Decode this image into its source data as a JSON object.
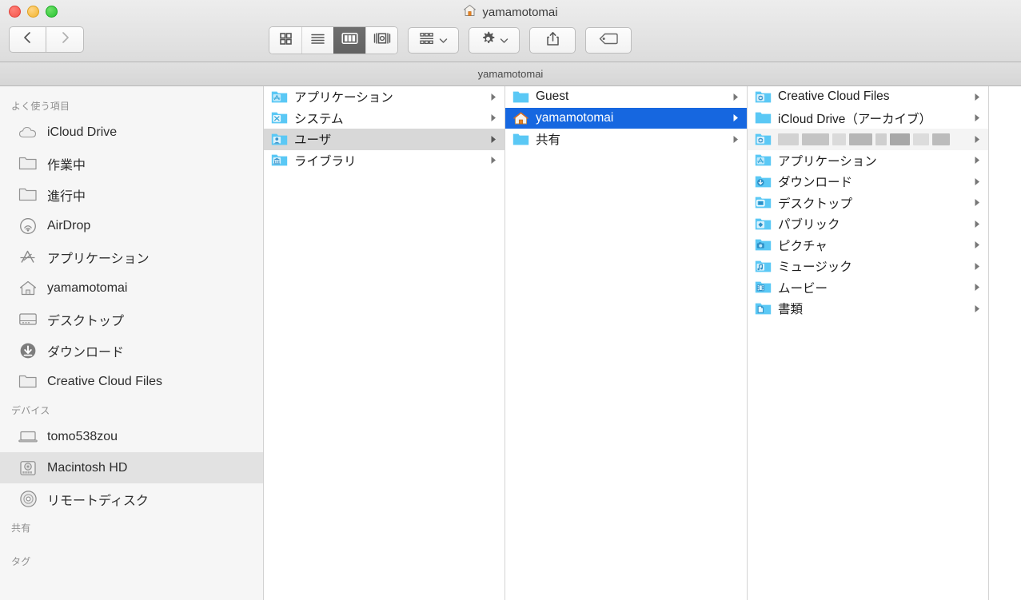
{
  "window": {
    "title": "yamamotomai",
    "title_icon": "home-icon",
    "path_bar_label": "yamamotomai",
    "accent_selection": "#1667e0",
    "folder_blue": "#5ac8f5",
    "sidebar_bg": "#f6f6f6"
  },
  "traffic_lights": [
    {
      "name": "close-button",
      "color": "#f4564c"
    },
    {
      "name": "minimize-button",
      "color": "#f2b42f"
    },
    {
      "name": "zoom-button",
      "color": "#28c231"
    }
  ],
  "nav": {
    "back_label": "back-arrow-icon",
    "forward_label": "forward-arrow-icon"
  },
  "toolbar": {
    "view_modes": [
      {
        "label": "icon-view",
        "icon": "grid-icon",
        "active": false
      },
      {
        "label": "list-view",
        "icon": "list-icon",
        "active": false
      },
      {
        "label": "column-view",
        "icon": "columns-icon",
        "active": true
      },
      {
        "label": "coverflow-view",
        "icon": "coverflow-icon",
        "active": false
      }
    ],
    "arrange_label": "arrange-icon",
    "action_label": "gear-icon",
    "share_label": "share-icon",
    "tags_label": "tag-icon"
  },
  "sidebar": {
    "sections": [
      {
        "header": "よく使う項目",
        "items": [
          {
            "label": "iCloud Drive",
            "icon": "icloud-icon",
            "selected": false
          },
          {
            "label": "作業中",
            "icon": "folder-icon",
            "selected": false
          },
          {
            "label": "進行中",
            "icon": "folder-icon",
            "selected": false
          },
          {
            "label": "AirDrop",
            "icon": "airdrop-icon",
            "selected": false
          },
          {
            "label": "アプリケーション",
            "icon": "applications-icon",
            "selected": false
          },
          {
            "label": "yamamotomai",
            "icon": "home-icon",
            "selected": false
          },
          {
            "label": "デスクトップ",
            "icon": "desktop-icon",
            "selected": false
          },
          {
            "label": "ダウンロード",
            "icon": "downloads-icon",
            "selected": false
          },
          {
            "label": "Creative Cloud Files",
            "icon": "folder-icon",
            "selected": false
          }
        ]
      },
      {
        "header": "デバイス",
        "items": [
          {
            "label": "tomo538zou",
            "icon": "laptop-icon",
            "selected": false
          },
          {
            "label": "Macintosh HD",
            "icon": "harddisk-icon",
            "selected": true
          },
          {
            "label": "リモートディスク",
            "icon": "disc-icon",
            "selected": false
          }
        ]
      },
      {
        "header": "共有",
        "items": []
      },
      {
        "header": "タグ",
        "items": []
      }
    ]
  },
  "columns": [
    {
      "name": "column-macintosh-hd",
      "rows": [
        {
          "label": "アプリケーション",
          "icon": "folder-applications-icon",
          "state": "none",
          "redacted": false
        },
        {
          "label": "システム",
          "icon": "folder-system-icon",
          "state": "none",
          "redacted": false
        },
        {
          "label": "ユーザ",
          "icon": "folder-users-icon",
          "state": "selected-inactive",
          "redacted": false
        },
        {
          "label": "ライブラリ",
          "icon": "folder-library-icon",
          "state": "none",
          "redacted": false
        }
      ]
    },
    {
      "name": "column-users",
      "rows": [
        {
          "label": "Guest",
          "icon": "folder-icon",
          "state": "none",
          "redacted": false
        },
        {
          "label": "yamamotomai",
          "icon": "home-icon",
          "state": "selected-active",
          "redacted": false
        },
        {
          "label": "共有",
          "icon": "folder-icon",
          "state": "none",
          "redacted": false
        }
      ]
    },
    {
      "name": "column-yamamotomai",
      "rows": [
        {
          "label": "Creative Cloud Files",
          "icon": "folder-alias-icon",
          "state": "none",
          "redacted": false
        },
        {
          "label": "iCloud Drive（アーカイブ）",
          "icon": "folder-icon",
          "state": "none",
          "redacted": false
        },
        {
          "label": "",
          "icon": "folder-alias-icon",
          "state": "none",
          "redacted": true
        },
        {
          "label": "アプリケーション",
          "icon": "folder-applications-icon",
          "state": "none",
          "redacted": false
        },
        {
          "label": "ダウンロード",
          "icon": "folder-downloads-icon",
          "state": "none",
          "redacted": false
        },
        {
          "label": "デスクトップ",
          "icon": "folder-desktop-icon",
          "state": "none",
          "redacted": false
        },
        {
          "label": "パブリック",
          "icon": "folder-public-icon",
          "state": "none",
          "redacted": false
        },
        {
          "label": "ピクチャ",
          "icon": "folder-pictures-icon",
          "state": "none",
          "redacted": false
        },
        {
          "label": "ミュージック",
          "icon": "folder-music-icon",
          "state": "none",
          "redacted": false
        },
        {
          "label": "ムービー",
          "icon": "folder-movies-icon",
          "state": "none",
          "redacted": false
        },
        {
          "label": "書類",
          "icon": "folder-documents-icon",
          "state": "none",
          "redacted": false
        }
      ]
    },
    {
      "name": "column-empty",
      "rows": []
    }
  ]
}
